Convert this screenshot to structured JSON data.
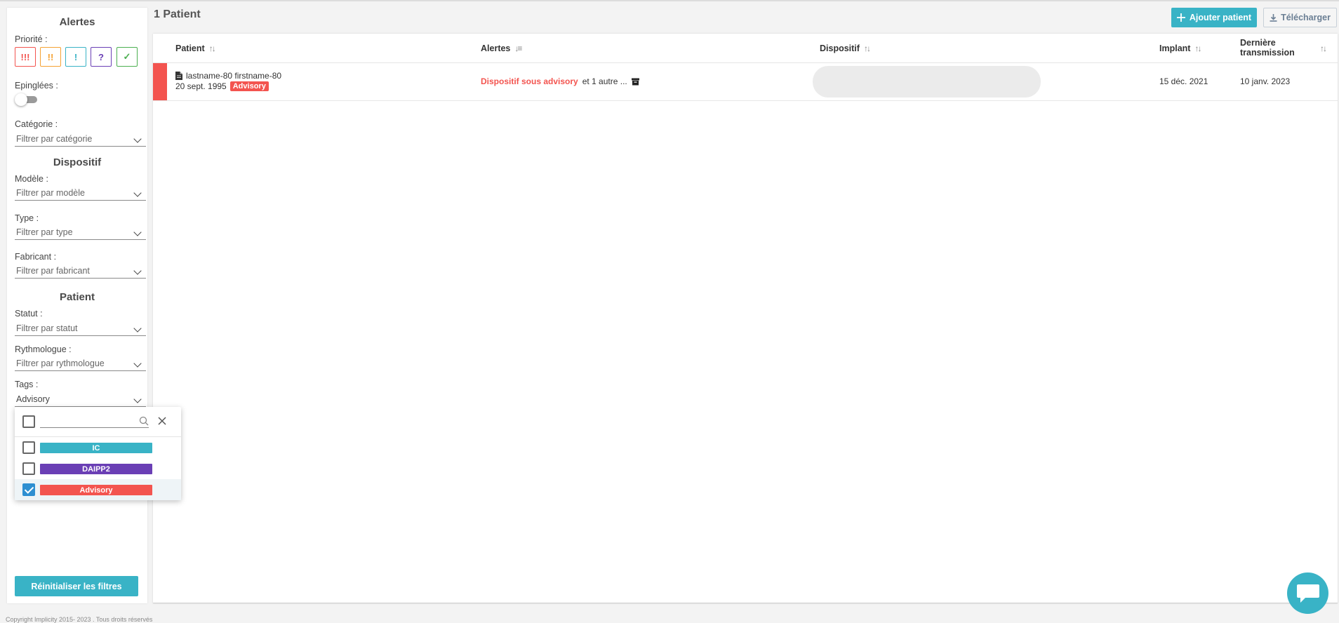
{
  "sidebar": {
    "alertes_title": "Alertes",
    "priority_label": "Priorité :",
    "priority_buttons": [
      {
        "label": "!!!",
        "color": "#f3544f"
      },
      {
        "label": "!!",
        "color": "#f5a233"
      },
      {
        "label": "!",
        "color": "#39b3c6"
      },
      {
        "label": "?",
        "color": "#6a3fb5"
      },
      {
        "label": "✓",
        "color": "#4caf50"
      }
    ],
    "pinned_label": "Epinglées :",
    "category_label": "Catégorie :",
    "category_placeholder": "Filtrer par catégorie",
    "dispositif_title": "Dispositif",
    "model_label": "Modèle :",
    "model_placeholder": "Filtrer par modèle",
    "type_label": "Type :",
    "type_placeholder": "Filtrer par type",
    "manufacturer_label": "Fabricant :",
    "manufacturer_placeholder": "Filtrer par fabricant",
    "patient_title": "Patient",
    "status_label": "Statut :",
    "status_placeholder": "Filtrer par statut",
    "rhythmologist_label": "Rythmologue :",
    "rhythmologist_placeholder": "Filtrer par rythmologue",
    "tags_label": "Tags :",
    "tags_value": "Advisory",
    "reset_button": "Réinitialiser les filtres"
  },
  "tags_dropdown": {
    "search_value": "",
    "options": [
      {
        "label": "IC",
        "color": "#39b3c6",
        "checked": false
      },
      {
        "label": "DAIPP2",
        "color": "#6a3fb5",
        "checked": false
      },
      {
        "label": "Advisory",
        "color": "#f3544f",
        "checked": true
      }
    ]
  },
  "header": {
    "title": "1 Patient",
    "add_button": "Ajouter patient",
    "download_button": "Télécharger"
  },
  "table": {
    "columns": [
      "Patient",
      "Alertes",
      "Dispositif",
      "Implant",
      "Dernière",
      "transmission"
    ],
    "rows": [
      {
        "name": "lastname-80 firstname-80",
        "birthdate": "20 sept. 1995",
        "tag": "Advisory",
        "alert": "Dispositif sous advisory",
        "alert_more": "et 1 autre ...",
        "implant": "15 déc. 2021",
        "last_transmission": "10 janv. 2023"
      }
    ]
  },
  "footer": "Copyright Implicity 2015- 2023 . Tous droits réservés"
}
